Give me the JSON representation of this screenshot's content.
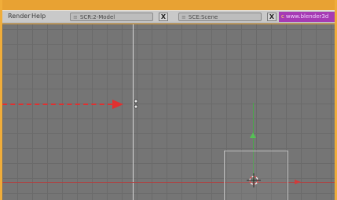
{
  "menu": {
    "render": "Render",
    "help": "Help"
  },
  "screen_field": {
    "grip": "≡",
    "value": "SCR:2-Model"
  },
  "scene_field": {
    "grip": "≡",
    "value": "SCE:Scene"
  },
  "close_label": "X",
  "url_bar": {
    "icon": "c",
    "text": "www.blender3d"
  },
  "colors": {
    "frame": "#e8a233",
    "header": "#c9c9c9",
    "viewport": "#757575",
    "x_axis": "#b04040",
    "y_axis": "#4aa64a",
    "annotation_arrow": "#e03030",
    "url_bg": "#a63bb4"
  }
}
